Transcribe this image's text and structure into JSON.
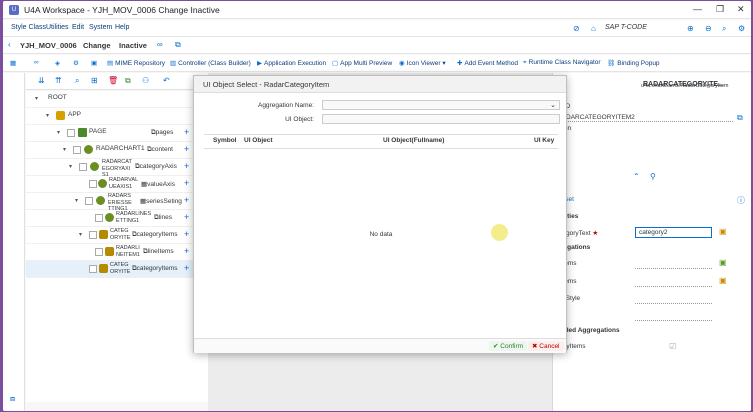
{
  "window": {
    "title": "U4A Workspace - YJH_MOV_0006 Change Inactive",
    "app_icon": "U"
  },
  "menu": [
    "Style Class",
    "Utilities",
    "Edit",
    "System",
    "Help"
  ],
  "tcode": "SAP T-CODE",
  "header": {
    "app": "YJH_MOV_0006",
    "mode": "Change",
    "status": "Inactive"
  },
  "toolbar": [
    "MIME Repository",
    "Controller (Class Builder)",
    "Application Execution",
    "App Multi Preview",
    "Icon Viewer",
    "Add Event Method",
    "Runtime Class Navigator",
    "Binding Popup"
  ],
  "tree": {
    "root": "ROOT",
    "app": "APP",
    "page": "PAGE",
    "page_agg": "pages",
    "chart": "RADARCHART1",
    "chart_agg": "content",
    "n1": "RADARCAT EGORYAXI S1",
    "n1_agg": "categoryAxis",
    "n2": "RADARVAL UEAXIS1",
    "n2_agg": "valueAxis",
    "n3": "RADARS ERIESSE TTING1",
    "n3_agg": "seriesSeting",
    "n4": "RADARLINES ETTING1",
    "n4_agg": "lines",
    "n5": "CATEG ORYITE",
    "n5_agg": "categoryItems",
    "n6": "RADARLI NEITEM1",
    "n6_agg": "lineItems",
    "n7": "CATEG ORYITE",
    "n7_agg": "categoryItems"
  },
  "dialog": {
    "title": "UI Object Select - RadarCategoryItem",
    "agg_label": "Aggregation Name:",
    "obj_label": "UI Object:",
    "cols": [
      "Symbol",
      "UI Object",
      "UI Object(Fullname)",
      "UI Key"
    ],
    "empty": "No data",
    "confirm": "Confirm",
    "cancel": "Cancel"
  },
  "right": {
    "header": "RADARCATEGORYITE...",
    "class": "u4a.charts.am5.RadarCategoryItem",
    "id_label": "ct ID",
    "id_value": "RADARCATEGORYITEM2",
    "desc_label": "ption",
    "reset": "Reset",
    "props": "perties",
    "cat_label": "ategoryText",
    "cat_value": "category2",
    "aggs": "gregations",
    "a1": "eItems",
    "a2": "eItems",
    "a3": "belStyle",
    "a4": "ld",
    "emb": "edded Aggregations",
    "e1": "goryItems"
  }
}
